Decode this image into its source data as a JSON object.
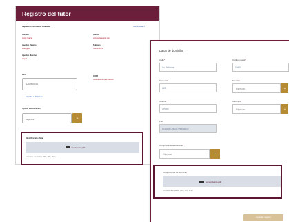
{
  "back": {
    "header_title": "Registro del tutor",
    "section_label": "Captura la información solicitada",
    "help_link": "Tienes dudas?",
    "rows": [
      {
        "l_label": "Nombre",
        "l_value": "Jorge Garcia",
        "r_label": "Correo",
        "r_value": "correo@ejemplo.com"
      },
      {
        "l_label": "Apellido Paterno",
        "l_value": "Rodriguez",
        "r_label": "Teléfono",
        "r_value": "5512345678"
      },
      {
        "l_label": "Apellido Materno",
        "l_value": "López",
        "r_label": "CURP",
        "r_value": "GARJ800101HDFRRG09"
      }
    ],
    "rfc_label": "RFC",
    "rfc_value": "GARJ800101",
    "link_text": "Consulta tu RFC aquí",
    "doc_type_label": "Tipo de identificación",
    "doc_type_value": "Elige una",
    "id_label": "Identificación oficial",
    "id_file": "documento.pdf",
    "id_hint": "Formatos aceptados: PDF, JPG, PNG"
  },
  "front": {
    "title": "Datos de domicilio",
    "calle_label": "Calle",
    "calle_value": "Av. Reforma",
    "cp_label": "Código postal",
    "cp_value": "06600",
    "numero_label": "Número",
    "numero_value": "123",
    "estado_label": "Estado",
    "estado_value": "Elige uno",
    "colonia_label": "Colonia",
    "colonia_value": "Centro",
    "municipio_label": "Municipio",
    "municipio_value": "Elige uno",
    "pais_label": "País",
    "pais_value": "Estados Unidos Mexicanos",
    "proof_type_label": "Comprobante de domicilio",
    "proof_type_value": "Elige uno",
    "proof_label": "Comprobante de domicilio",
    "proof_file": "comprobante.pdf",
    "proof_hint": "Formatos aceptados: PDF, JPG, PNG",
    "save_label": "Guardar registro"
  },
  "colors": {
    "brand": "#6b1f3a",
    "accent": "#b58c34"
  }
}
